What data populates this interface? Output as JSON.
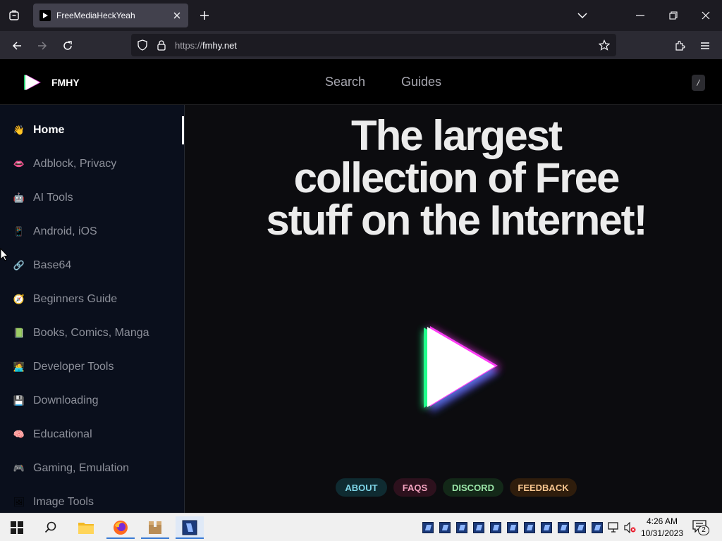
{
  "browser": {
    "tab_title": "FreeMediaHeckYeah",
    "url_scheme": "https://",
    "url_host": "fmhy.net"
  },
  "header": {
    "brand": "FMHY",
    "nav": [
      "Search",
      "Guides"
    ],
    "shortcut_key": "/"
  },
  "sidebar": {
    "items": [
      {
        "label": "Home",
        "icon": "waving-hand-icon",
        "emoji": "👋",
        "active": true
      },
      {
        "label": "Adblock, Privacy",
        "icon": "lips-icon",
        "emoji": "👄"
      },
      {
        "label": "AI Tools",
        "icon": "robot-icon",
        "emoji": "🤖"
      },
      {
        "label": "Android, iOS",
        "icon": "phone-icon",
        "emoji": "📱"
      },
      {
        "label": "Base64",
        "icon": "link-icon",
        "emoji": "🔗"
      },
      {
        "label": "Beginners Guide",
        "icon": "guide-icon",
        "emoji": "🧭"
      },
      {
        "label": "Books, Comics, Manga",
        "icon": "green-book-icon",
        "emoji": "📗"
      },
      {
        "label": "Developer Tools",
        "icon": "technologist-icon",
        "emoji": "🧑‍💻"
      },
      {
        "label": "Downloading",
        "icon": "floppy-disk-icon",
        "emoji": "💾"
      },
      {
        "label": "Educational",
        "icon": "brain-icon",
        "emoji": "🧠"
      },
      {
        "label": "Gaming, Emulation",
        "icon": "game-controller-icon",
        "emoji": "🎮"
      },
      {
        "label": "Image Tools",
        "icon": "picture-icon",
        "emoji": "🖼"
      }
    ]
  },
  "hero": {
    "line1": "The largest",
    "line2": "collection of Free",
    "line3": "stuff on the Internet!"
  },
  "buttons": {
    "about": "ABOUT",
    "faqs": "FAQS",
    "discord": "DISCORD",
    "feedback": "FEEDBACK"
  },
  "taskbar": {
    "time": "4:26 AM",
    "date": "10/31/2023",
    "notification_count": "2"
  },
  "colors": {
    "about": "#7fd6e8",
    "faqs": "#f5a3c0",
    "discord": "#9be6a8",
    "feedback": "#f7c58f"
  }
}
